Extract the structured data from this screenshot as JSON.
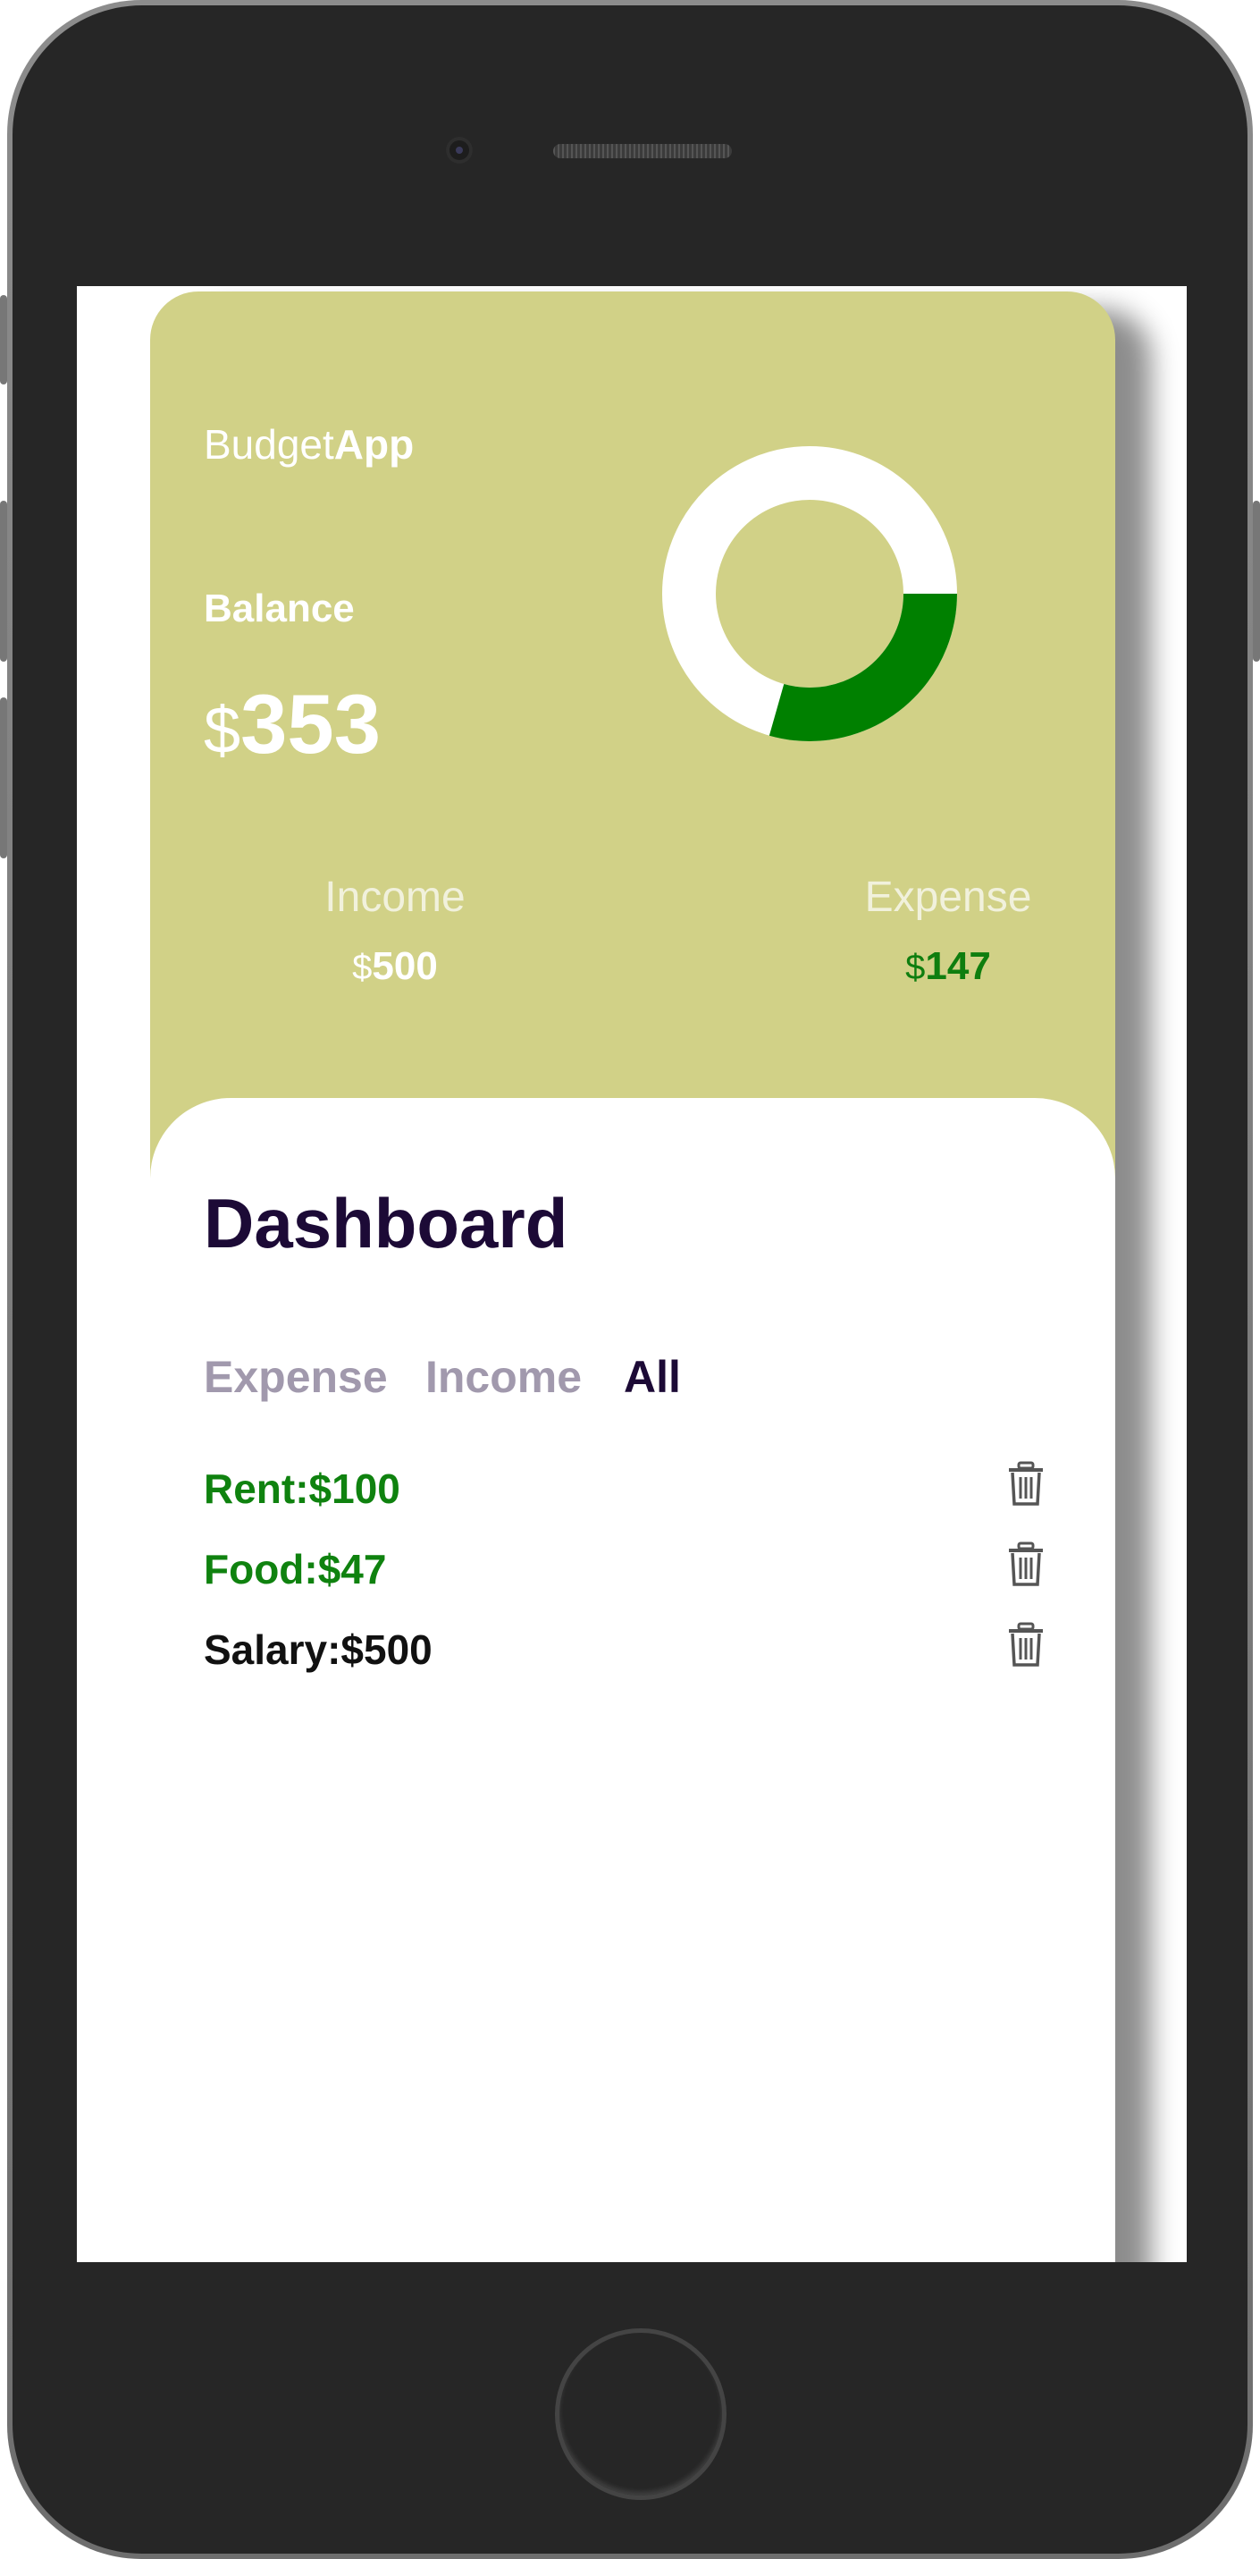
{
  "app": {
    "brand_light": "Budget",
    "brand_bold": "App",
    "balance_label": "Balance",
    "currency": "$",
    "balance_value": "353",
    "income_label": "Income",
    "income_value": "500",
    "expense_label": "Expense",
    "expense_value": "147",
    "expense_share": 0.294,
    "colors": {
      "header_bg": "#d1d187",
      "expense_green": "#0f820f",
      "title_dark": "#1c0a36",
      "filter_inactive": "#a199ad"
    }
  },
  "dashboard": {
    "title": "Dashboard",
    "filters": [
      "Expense",
      "Income",
      "All"
    ],
    "active_filter": "All",
    "transactions": [
      {
        "text": "Rent:$100",
        "type": "expense"
      },
      {
        "text": "Food:$47",
        "type": "expense"
      },
      {
        "text": "Salary:$500",
        "type": "income"
      }
    ],
    "delete_icon": "trash-icon"
  }
}
